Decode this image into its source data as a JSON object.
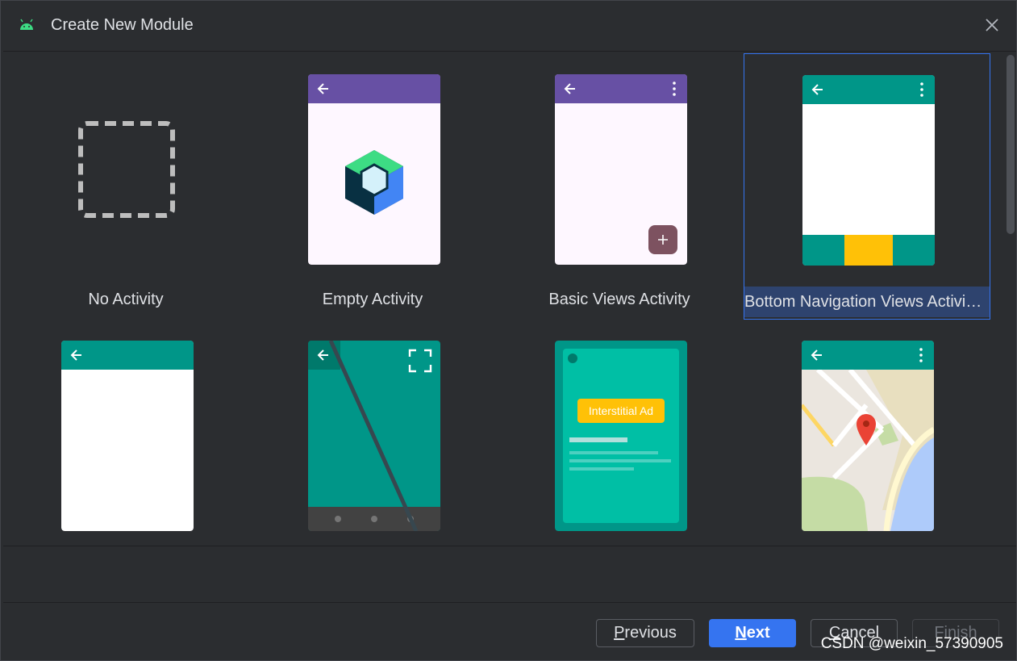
{
  "dialog": {
    "title": "Create New Module"
  },
  "templates": [
    {
      "label": "No Activity"
    },
    {
      "label": "Empty Activity"
    },
    {
      "label": "Basic Views Activity"
    },
    {
      "label": "Bottom Navigation Views Activity",
      "display": "Bottom Navigation Views Activi…",
      "selected": true
    },
    {
      "label": ""
    },
    {
      "label": ""
    },
    {
      "label": ""
    },
    {
      "label": ""
    }
  ],
  "previews": {
    "interstitial_ad_label": "Interstitial Ad"
  },
  "buttons": {
    "previous_prefix": "",
    "previous_mnemonic": "P",
    "previous_rest": "revious",
    "next_mnemonic": "N",
    "next_rest": "ext",
    "cancel_mnemonic": "C",
    "cancel_rest": "ancel",
    "finish_label": "Finish"
  },
  "watermark": "CSDN @weixin_57390905",
  "colors": {
    "accent": "#3574f0",
    "purple_bar": "#6750a4",
    "teal_bar": "#009688",
    "amber": "#ffc107",
    "background": "#2b2d30"
  }
}
